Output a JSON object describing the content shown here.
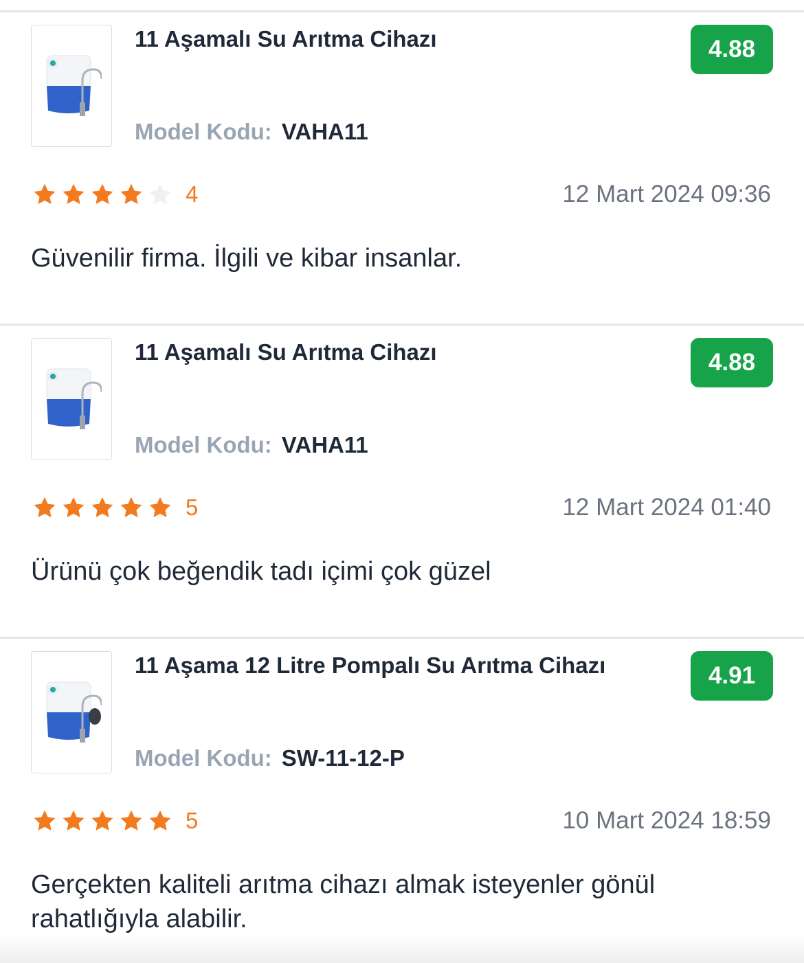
{
  "model_label": "Model Kodu:",
  "reviews": [
    {
      "product_title": "11 Aşamalı Su Arıtma Cihazı",
      "product_score": "4.88",
      "model_code": "VAHA11",
      "stars": 4,
      "rating": "4",
      "date": "12 Mart 2024 09:36",
      "comment": "Güvenilir firma. İlgili ve kibar insanlar."
    },
    {
      "product_title": "11 Aşamalı Su Arıtma Cihazı",
      "product_score": "4.88",
      "model_code": "VAHA11",
      "stars": 5,
      "rating": "5",
      "date": "12 Mart 2024 01:40",
      "comment": "Ürünü çok beğendik tadı içimi çok güzel"
    },
    {
      "product_title": "11 Aşama 12 Litre Pompalı Su Arıtma Cihazı",
      "product_score": "4.91",
      "model_code": "SW-11-12-P",
      "stars": 5,
      "rating": "5",
      "date": "10 Mart 2024 18:59",
      "comment": "Gerçekten kaliteli arıtma cihazı almak isteyenler gönül rahatlığıyla alabilir."
    }
  ],
  "colors": {
    "star_filled": "#f47a20",
    "star_empty": "#eef0f4",
    "score_badge": "#16a34a"
  }
}
